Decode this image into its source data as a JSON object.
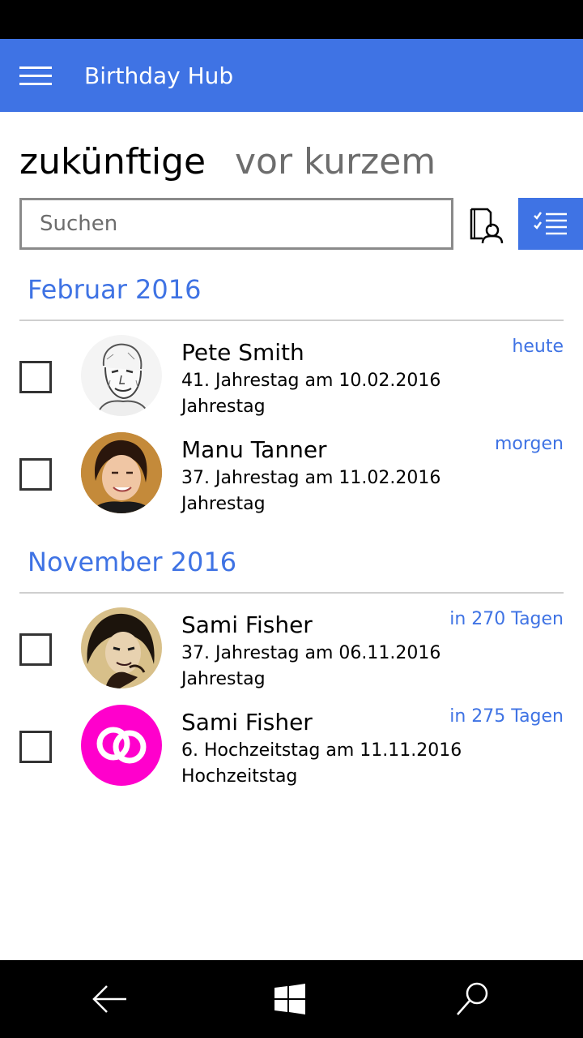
{
  "app": {
    "title": "Birthday Hub"
  },
  "colors": {
    "accent": "#3f73e4",
    "wedding_avatar": "#ff00cc"
  },
  "pivots": {
    "upcoming": "zukünftige",
    "recent": "vor kurzem"
  },
  "search": {
    "placeholder": "Suchen",
    "value": ""
  },
  "sections": [
    {
      "header": "Februar 2016",
      "items": [
        {
          "name": "Pete Smith",
          "detail": "41. Jahrestag am 10.02.2016",
          "kind": "Jahrestag",
          "when": "heute",
          "checked": false,
          "avatar": "sketch-photo"
        },
        {
          "name": "Manu Tanner",
          "detail": "37. Jahrestag am 11.02.2016",
          "kind": "Jahrestag",
          "when": "morgen",
          "checked": false,
          "avatar": "photo"
        }
      ]
    },
    {
      "header": "November 2016",
      "items": [
        {
          "name": "Sami Fisher",
          "detail": "37. Jahrestag am 06.11.2016",
          "kind": "Jahrestag",
          "when": "in 270 Tagen",
          "checked": false,
          "avatar": "photo"
        },
        {
          "name": "Sami Fisher",
          "detail": "6. Hochzeitstag am 11.11.2016",
          "kind": "Hochzeitstag",
          "when": "in 275 Tagen",
          "checked": false,
          "avatar": "rings-icon"
        }
      ]
    }
  ],
  "icons": {
    "menu": "hamburger-icon",
    "contacts": "contact-book-icon",
    "select": "multi-select-checklist-icon",
    "back": "back-arrow-icon",
    "home": "windows-logo-icon",
    "search": "search-icon"
  }
}
